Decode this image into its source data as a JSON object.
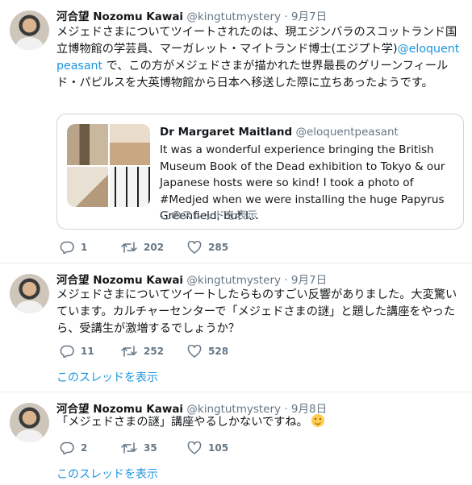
{
  "tweets": [
    {
      "name": "河合望 Nozomu Kawai",
      "handle": "@kingtutmystery",
      "separator": "·",
      "time": "9月7日",
      "text_before": "メジェドさまについてツイートされたのは、現エジンバラのスコットランド国立博物館の学芸員、マーガレット・マイトランド博士(エジプト学)",
      "mention": "@eloquentpeasant",
      "text_after": " で、この方がメジェドさまが描かれた世界最長のグリーンフィールド・パピルスを大英博物館から日本へ移送した際に立ちあったようです。",
      "quote": {
        "name": "Dr Margaret Maitland",
        "handle": "@eloquentpeasant",
        "text": "It was a wonderful experience bringing the British Museum Book of the Dead exhibition to Tokyo & our Japanese hosts were so kind! I took a photo of #Medjed when we were installing the huge Papyrus Greenfield, but I...",
        "show_thread": "このスレッドを表示"
      },
      "replies": "1",
      "retweets": "202",
      "likes": "285"
    },
    {
      "name": "河合望 Nozomu Kawai",
      "handle": "@kingtutmystery",
      "separator": "·",
      "time": "9月7日",
      "text": "メジェドさまについてツイートしたらものすごい反響がありました。大変驚いています。カルチャーセンターで「メジェドさまの謎」と題した講座をやったら、受講生が激増するでしょうか？",
      "replies": "11",
      "retweets": "252",
      "likes": "528",
      "show_thread": "このスレッドを表示"
    },
    {
      "name": "河合望 Nozomu Kawai",
      "handle": "@kingtutmystery",
      "separator": "·",
      "time": "9月8日",
      "text": "「メジェドさまの謎」講座やるしかないですね。",
      "replies": "2",
      "retweets": "35",
      "likes": "105",
      "show_thread": "このスレッドを表示"
    }
  ],
  "icons": {
    "reply": "reply-icon",
    "retweet": "retweet-icon",
    "like": "heart-icon",
    "emoji": "smiling-face-emoji"
  },
  "colors": {
    "link": "#1b95e0",
    "secondary": "#657786",
    "divider": "#e6ecf0"
  }
}
